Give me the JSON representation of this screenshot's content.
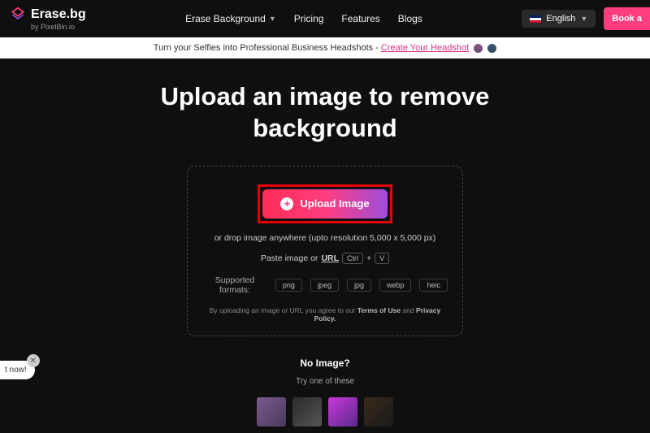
{
  "header": {
    "logo_title": "Erase.bg",
    "logo_sub": "by PixelBin.io",
    "nav": {
      "erase_bg": "Erase Background",
      "pricing": "Pricing",
      "features": "Features",
      "blogs": "Blogs"
    },
    "language": "English",
    "book": "Book a"
  },
  "banner": {
    "text_pre": "Turn your Selfies into Professional Business Headshots - ",
    "cta": "Create Your Headshot"
  },
  "hero": {
    "title_l1": "Upload an image to remove",
    "title_l2": "background"
  },
  "upload": {
    "button": "Upload Image",
    "drop_hint": "or drop image anywhere (upto resolution 5,000 x 5,000 px)",
    "paste_pre": "Paste image or",
    "url": "URL",
    "key1": "Ctrl",
    "key_plus": "+",
    "key2": "V",
    "formats_label": "Supported formats:",
    "formats": [
      "png",
      "jpeg",
      "jpg",
      "webp",
      "heic"
    ],
    "disclaimer_pre": "By uploading an image or URL you agree to our ",
    "terms": "Terms of Use",
    "disclaimer_mid": " and ",
    "privacy": "Privacy Policy."
  },
  "noimage": {
    "title": "No Image?",
    "sub": "Try one of these"
  },
  "chat": {
    "text": "t now!"
  }
}
